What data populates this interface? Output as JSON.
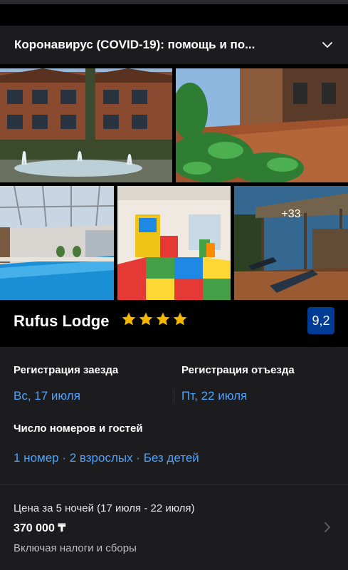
{
  "covid": {
    "text": "Коронавирус (COVID-19): помощь и по..."
  },
  "gallery": {
    "more_count": "+33"
  },
  "hotel": {
    "name": "Rufus Lodge",
    "stars": 4,
    "score": "9,2"
  },
  "checkin": {
    "label": "Регистрация заезда",
    "value": "Вс, 17 июля"
  },
  "checkout": {
    "label": "Регистрация отъезда",
    "value": "Пт, 22 июля"
  },
  "rooms": {
    "label": "Число номеров и гостей",
    "value": "1 номер · 2 взрослых · Без детей"
  },
  "price": {
    "label": "Цена за 5 ночей (17 июля - 22 июля)",
    "value": "370 000 ₸",
    "note": "Включая налоги и сборы"
  },
  "colors": {
    "accent": "#4ba3ff",
    "score_bg": "#003b95",
    "star": "#f5b700"
  }
}
